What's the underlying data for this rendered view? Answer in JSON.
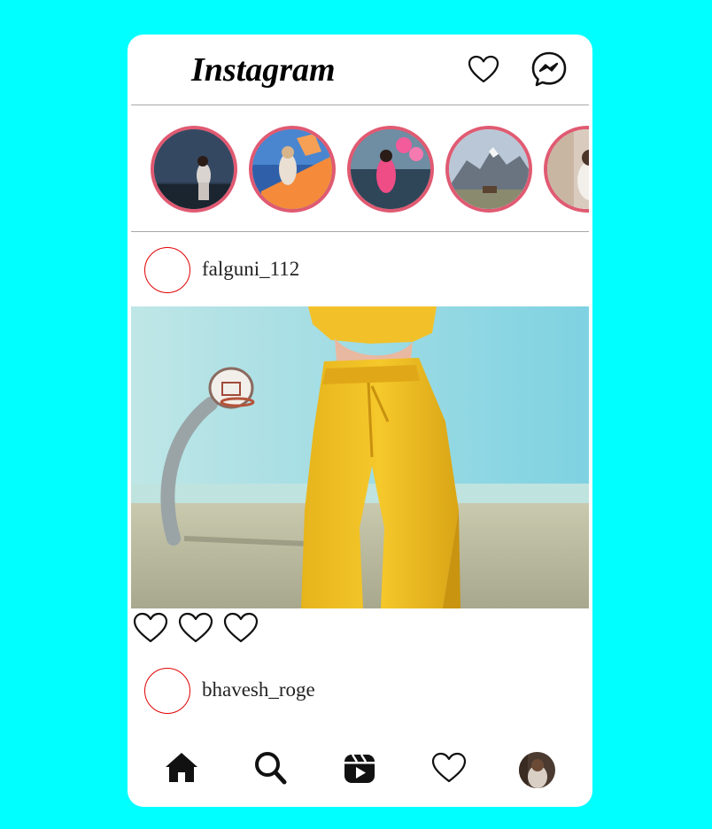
{
  "header": {
    "app_title": "Instagram",
    "notifications_icon": "heart-outline-icon",
    "messages_icon": "messenger-icon"
  },
  "stories": [
    {
      "name": "story-1"
    },
    {
      "name": "story-2"
    },
    {
      "name": "story-3"
    },
    {
      "name": "story-4"
    },
    {
      "name": "story-5"
    }
  ],
  "posts": [
    {
      "username": "falguni_112"
    },
    {
      "username": "bhavesh_roge"
    }
  ],
  "post_actions": [
    "heart-outline-icon",
    "heart-outline-icon",
    "heart-outline-icon"
  ],
  "nav": {
    "items": [
      "home-icon",
      "search-icon",
      "reels-icon",
      "heart-outline-icon",
      "profile-avatar"
    ]
  },
  "colors": {
    "background": "#00ffff",
    "story_ring": "#e05a72",
    "avatar_ring": "#e00000"
  }
}
